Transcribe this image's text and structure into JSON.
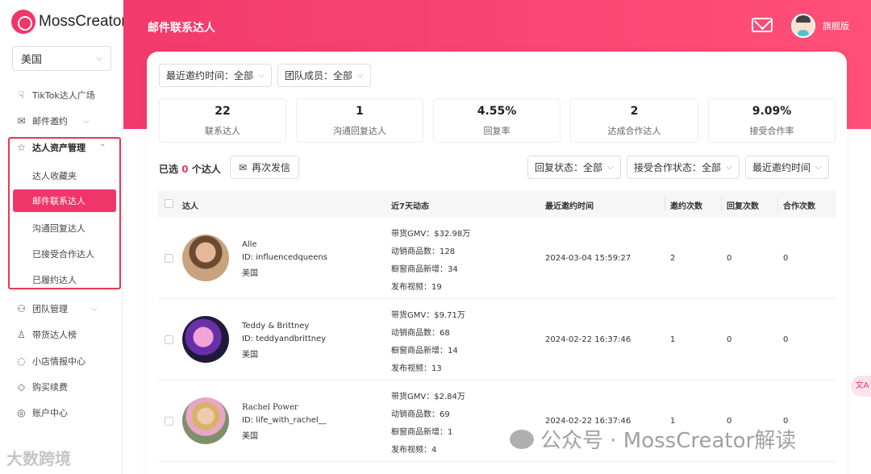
{
  "app": {
    "logo_text": "MossCreator",
    "region": "美国"
  },
  "sidebar": {
    "items": [
      {
        "label": "TikTok达人广场",
        "icon": "plaza-icon"
      },
      {
        "label": "邮件邀约",
        "icon": "mail-icon"
      },
      {
        "label": "达人资产管理",
        "icon": "star-icon"
      },
      {
        "label": "团队管理",
        "icon": "team-icon"
      },
      {
        "label": "带货达人榜",
        "icon": "user-icon"
      },
      {
        "label": "小店情报中心",
        "icon": "chat-icon"
      },
      {
        "label": "购买续费",
        "icon": "diamond-icon"
      },
      {
        "label": "账户中心",
        "icon": "account-icon"
      }
    ],
    "sub_items": [
      "达人收藏夹",
      "邮件联系达人",
      "沟通回复达人",
      "已接受合作达人",
      "已履约达人"
    ]
  },
  "header": {
    "title": "邮件联系达人",
    "plan": "旗舰版"
  },
  "filters": {
    "last_invite": "最近邀约时间：全部",
    "team_member": "团队成员：全部",
    "reply_status": "回复状态：全部",
    "accept_status": "接受合作状态：全部",
    "sort": "最近邀约时间"
  },
  "stats": [
    {
      "value": "22",
      "label": "联系达人"
    },
    {
      "value": "1",
      "label": "沟通回复达人"
    },
    {
      "value": "4.55%",
      "label": "回复率"
    },
    {
      "value": "2",
      "label": "达成合作达人"
    },
    {
      "value": "9.09%",
      "label": "接受合作率"
    }
  ],
  "selection": {
    "prefix": "已选",
    "count": "0",
    "suffix": "个达人",
    "resend": "再次发信"
  },
  "table": {
    "headers": [
      "达人",
      "近7天动态",
      "最近邀约时间",
      "邀约次数",
      "回复次数",
      "合作次数"
    ],
    "rows": [
      {
        "name": "Alle",
        "id": "ID: influencedqueens",
        "country": "美国",
        "gmv": "带货GMV：$32.98万",
        "products": "动销商品数：128",
        "new_items": "橱窗商品新增：34",
        "videos": "发布视频：19",
        "time": "2024-03-04 15:59:27",
        "invites": "2",
        "replies": "0",
        "coops": "0"
      },
      {
        "name": "Teddy & Brittney",
        "id": "ID: teddyandbrittney",
        "country": "美国",
        "gmv": "带货GMV：$9.71万",
        "products": "动销商品数：68",
        "new_items": "橱窗商品新增：14",
        "videos": "发布视频：13",
        "time": "2024-02-22 16:37:46",
        "invites": "1",
        "replies": "0",
        "coops": "0"
      },
      {
        "name": "Rachel Power",
        "id": "ID: life_with_rachel__",
        "country": "美国",
        "gmv": "带货GMV：$2.84万",
        "products": "动销商品数：69",
        "new_items": "橱窗商品新增：1",
        "videos": "发布视频：4",
        "time": "2024-02-22 16:37:46",
        "invites": "1",
        "replies": "0",
        "coops": "0"
      }
    ]
  },
  "watermark": {
    "left": "大数跨境",
    "right": "公众号 · MossCreator解读"
  },
  "float_button": "文A"
}
